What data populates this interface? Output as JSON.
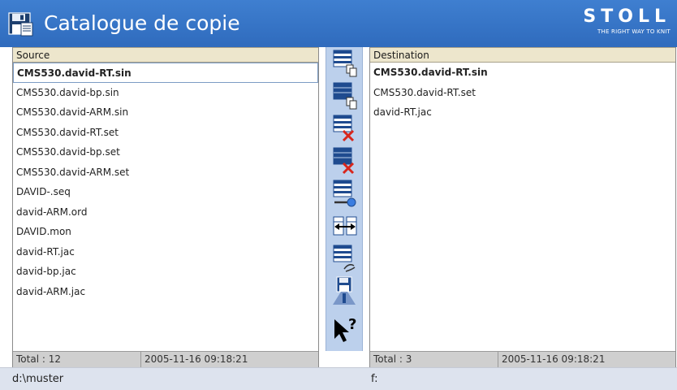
{
  "window": {
    "title": "Catalogue de copie"
  },
  "brand": {
    "name": "STOLL",
    "tagline": "THE RIGHT WAY TO KNIT"
  },
  "source": {
    "header": "Source",
    "files": [
      "CMS530.david-RT.sin",
      "CMS530.david-bp.sin",
      "CMS530.david-ARM.sin",
      "CMS530.david-RT.set",
      "CMS530.david-bp.set",
      "CMS530.david-ARM.set",
      "DAVID-.seq",
      "david-ARM.ord",
      "DAVID.mon",
      "david-RT.jac",
      "david-bp.jac",
      "david-ARM.jac"
    ],
    "total": "Total : 12",
    "date": "2005-11-16 09:18:21",
    "path": "d:\\muster"
  },
  "destination": {
    "header": "Destination",
    "files": [
      "CMS530.david-RT.sin",
      "CMS530.david-RT.set",
      "david-RT.jac"
    ],
    "total": "Total : 3",
    "date": "2005-11-16 09:18:21",
    "path": "f:"
  },
  "toolbar": {
    "icons": [
      "copy-selected-icon",
      "copy-all-icon",
      "delete-selected-icon",
      "delete-all-icon",
      "key-protect-icon",
      "swap-panes-icon",
      "refresh-convert-icon",
      "save-disk-icon",
      "help-pointer-icon"
    ]
  },
  "colors": {
    "titlebar": "#2f6bbd",
    "toolbar": "#bcd0ec",
    "header": "#ede6cc",
    "footer": "#cfcfcf",
    "accent_red": "#d8261c"
  }
}
